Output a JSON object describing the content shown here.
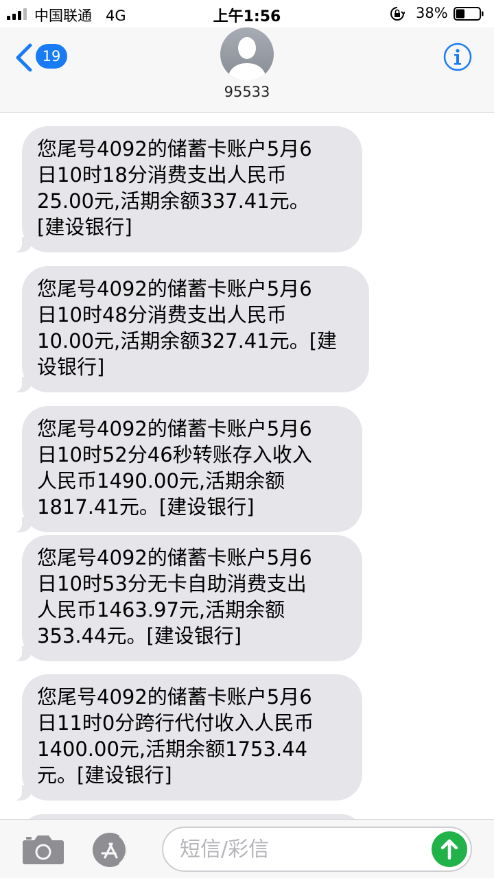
{
  "status_bar": {
    "carrier": "中国联通   4G",
    "time": "上午1:56",
    "battery_percent": "38%",
    "battery_level": 0.38,
    "signal_bars_filled": 3,
    "signal_bars_total": 4,
    "icons": [
      "signal-icon",
      "orientation-lock-icon",
      "battery-icon"
    ]
  },
  "header": {
    "back_badge": "19",
    "contact_name": "95533",
    "icons": [
      "back-chevron-icon",
      "avatar-icon",
      "info-icon"
    ],
    "accent_color": "#1a7cf4"
  },
  "messages": [
    {
      "text": "您尾号4092的储蓄卡账户5月6\n日10时18分消费支出人民币\n25.00元,活期余额337.41元。\n[建设银行]"
    },
    {
      "text": "您尾号4092的储蓄卡账户5月6\n日10时48分消费支出人民币\n10.00元,活期余额327.41元。[建\n设银行]"
    },
    {
      "text": "您尾号4092的储蓄卡账户5月6\n日10时52分46秒转账存入收入\n人民币1490.00元,活期余额\n1817.41元。[建设银行]"
    },
    {
      "text": "您尾号4092的储蓄卡账户5月6\n日10时53分无卡自助消费支出\n人民币1463.97元,活期余额\n353.44元。[建设银行]"
    },
    {
      "text": "您尾号4092的储蓄卡账户5月6\n日11时0分跨行代付收入人民币\n1400.00元,活期余额1753.44\n元。[建设银行]"
    },
    {
      "text": ""
    }
  ],
  "bubble_color": "#e5e5ea",
  "input_bar": {
    "placeholder": "短信/彩信",
    "value": "",
    "send_color": "#21b34a",
    "icons": [
      "camera-icon",
      "app-store-icon",
      "send-arrow-icon"
    ]
  }
}
